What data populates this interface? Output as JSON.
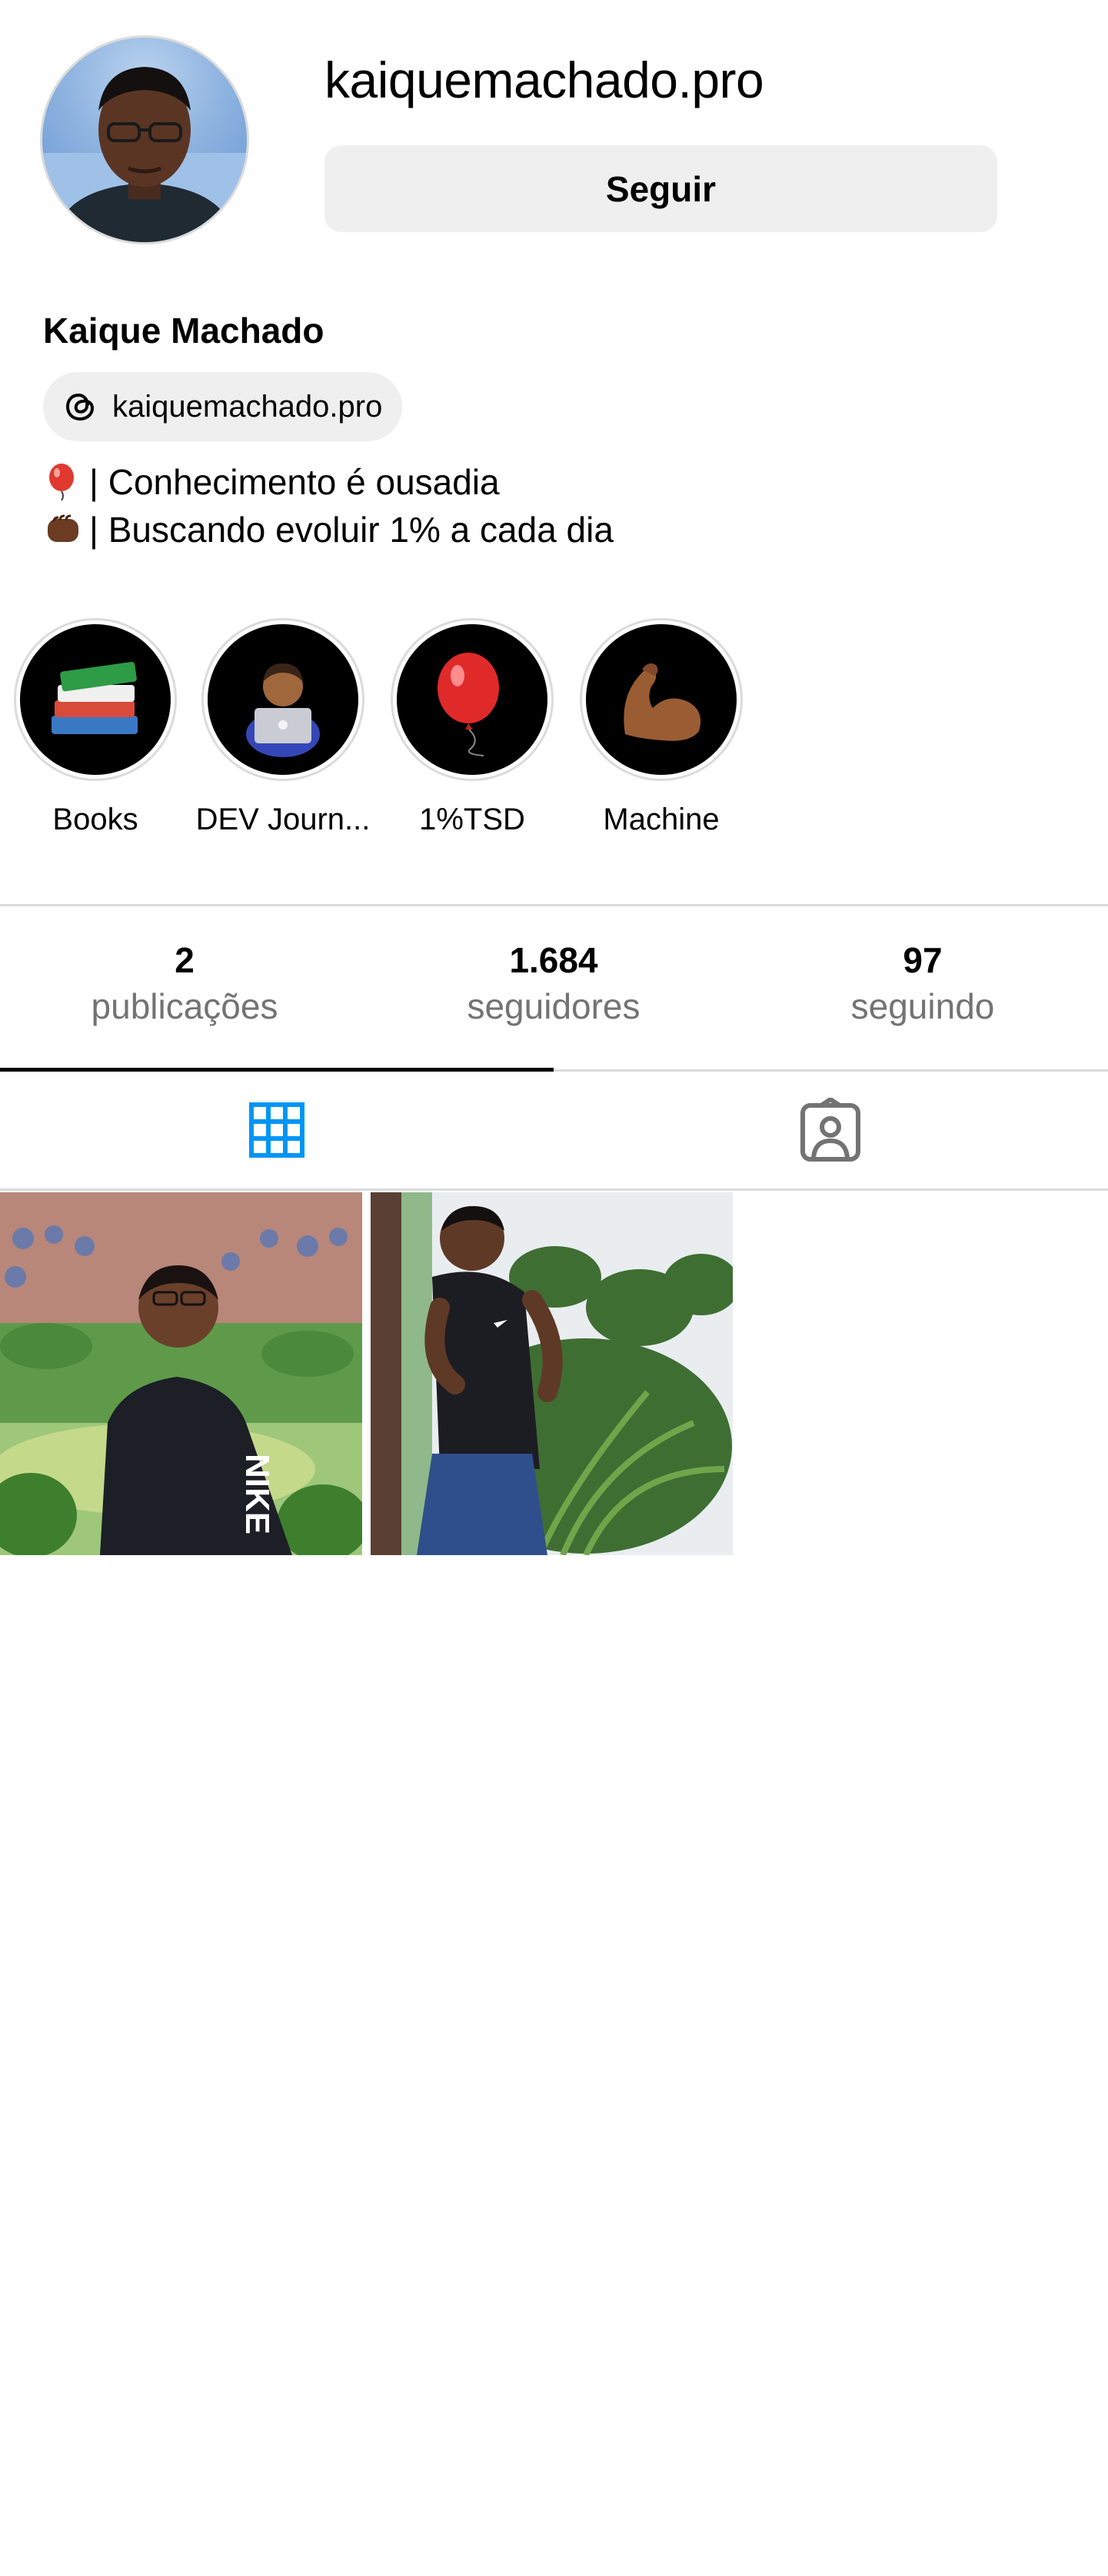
{
  "profile": {
    "username": "kaiquemachado.pro",
    "follow_label": "Seguir",
    "full_name": "Kaique Machado",
    "threads_handle": "kaiquemachado.pro",
    "bio": [
      {
        "emoji": "balloon-emoji",
        "text": "| Conhecimento é ousadia"
      },
      {
        "emoji": "fist-bump-emoji",
        "text": "| Buscando evoluir 1% a cada dia"
      }
    ]
  },
  "highlights": [
    {
      "label": "Books",
      "icon": "books-emoji"
    },
    {
      "label": "DEV Journ...",
      "icon": "technologist-emoji"
    },
    {
      "label": "1%TSD",
      "icon": "red-balloon-emoji"
    },
    {
      "label": "Machine",
      "icon": "flexed-biceps-emoji"
    }
  ],
  "stats": {
    "posts": {
      "value": "2",
      "label": "publicações"
    },
    "followers": {
      "value": "1.684",
      "label": "seguidores"
    },
    "following": {
      "value": "97",
      "label": "seguindo"
    }
  },
  "tabs": [
    {
      "name": "grid",
      "icon": "grid-icon",
      "active": true
    },
    {
      "name": "tagged",
      "icon": "tagged-person-icon",
      "active": false
    }
  ],
  "colors": {
    "accent_blue": "#0095f6",
    "muted_text": "#737373",
    "divider": "#dbdbdb",
    "button_bg": "#efefef"
  },
  "posts": [
    {
      "description": "photo-post-1"
    },
    {
      "description": "photo-post-2"
    }
  ]
}
